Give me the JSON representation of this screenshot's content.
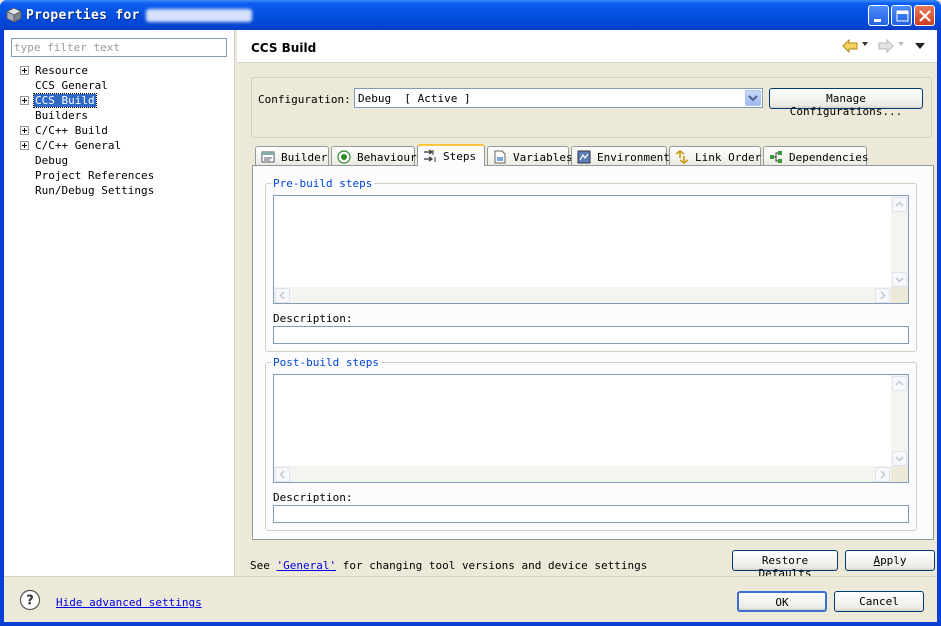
{
  "window": {
    "title": "Properties for"
  },
  "filter": {
    "placeholder": "type filter text"
  },
  "tree": [
    {
      "label": "Resource",
      "expandable": true,
      "selected": false
    },
    {
      "label": "CCS General",
      "expandable": false,
      "selected": false
    },
    {
      "label": "CCS Build",
      "expandable": true,
      "selected": true
    },
    {
      "label": "Builders",
      "expandable": false,
      "selected": false
    },
    {
      "label": "C/C++ Build",
      "expandable": true,
      "selected": false
    },
    {
      "label": "C/C++ General",
      "expandable": true,
      "selected": false
    },
    {
      "label": "Debug",
      "expandable": false,
      "selected": false
    },
    {
      "label": "Project References",
      "expandable": false,
      "selected": false
    },
    {
      "label": "Run/Debug Settings",
      "expandable": false,
      "selected": false
    }
  ],
  "page": {
    "title": "CCS Build",
    "config_label": "Configuration:",
    "config_value": "Debug  [ Active ]",
    "manage_label": "Manage Configurations...",
    "tabs": [
      {
        "label": "Builder",
        "icon": "builder-icon",
        "active": false
      },
      {
        "label": "Behaviour",
        "icon": "behaviour-icon",
        "active": false
      },
      {
        "label": "Steps",
        "icon": "steps-icon",
        "active": true
      },
      {
        "label": "Variables",
        "icon": "variables-icon",
        "active": false
      },
      {
        "label": "Environment",
        "icon": "environment-icon",
        "active": false
      },
      {
        "label": "Link Order",
        "icon": "link-order-icon",
        "active": false
      },
      {
        "label": "Dependencies",
        "icon": "dependencies-icon",
        "active": false
      }
    ],
    "pre_build": {
      "title": "Pre-build steps",
      "steps_value": "",
      "description_label": "Description:",
      "description_value": ""
    },
    "post_build": {
      "title": "Post-build steps",
      "steps_value": "",
      "description_label": "Description:",
      "description_value": ""
    },
    "info_prefix": "See ",
    "info_link": "'General'",
    "info_suffix": " for changing tool versions and device settings",
    "restore_label": "Restore Defaults",
    "apply_label": "Apply"
  },
  "footer": {
    "advanced_link": "Hide advanced settings",
    "ok_label": "OK",
    "cancel_label": "Cancel"
  },
  "colors": {
    "titlebar": "#0450e0",
    "selection": "#316ac5",
    "group_title": "#0046d5",
    "active_tab_accent": "#ffc83c"
  }
}
